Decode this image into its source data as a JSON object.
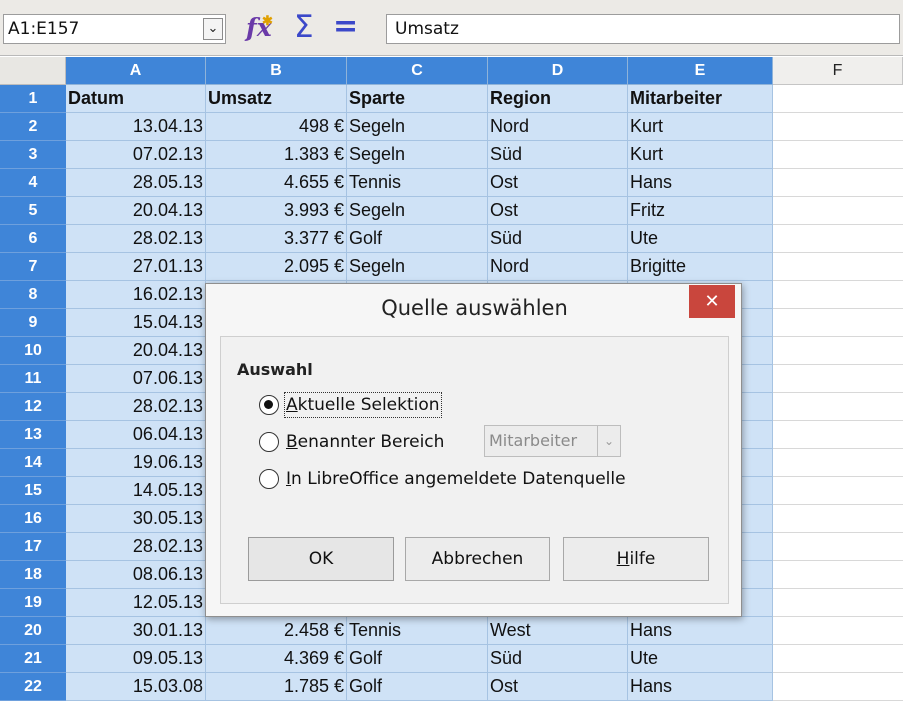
{
  "formula_bar": {
    "name_box": "A1:E157",
    "dropdown_glyph": "⌄",
    "function_wizard_icon": "function-wizard-icon",
    "fx_label": "fx",
    "sum_icon": "sum-icon",
    "sum_glyph": "Σ",
    "equals_icon": "equals-icon",
    "equals_glyph": "=",
    "content": "Umsatz"
  },
  "sheet": {
    "columns": [
      "A",
      "B",
      "C",
      "D",
      "E",
      "F"
    ],
    "rows": [
      {
        "num": "1",
        "cells": [
          "Datum",
          "Umsatz",
          "Sparte",
          "Region",
          "Mitarbeiter"
        ]
      },
      {
        "num": "2",
        "cells": [
          "13.04.13",
          "498 €",
          "Segeln",
          "Nord",
          "Kurt"
        ]
      },
      {
        "num": "3",
        "cells": [
          "07.02.13",
          "1.383 €",
          "Segeln",
          "Süd",
          "Kurt"
        ]
      },
      {
        "num": "4",
        "cells": [
          "28.05.13",
          "4.655 €",
          "Tennis",
          "Ost",
          "Hans"
        ]
      },
      {
        "num": "5",
        "cells": [
          "20.04.13",
          "3.993 €",
          "Segeln",
          "Ost",
          "Fritz"
        ]
      },
      {
        "num": "6",
        "cells": [
          "28.02.13",
          "3.377 €",
          "Golf",
          "Süd",
          "Ute"
        ]
      },
      {
        "num": "7",
        "cells": [
          "27.01.13",
          "2.095 €",
          "Segeln",
          "Nord",
          "Brigitte"
        ]
      },
      {
        "num": "8",
        "cells": [
          "16.02.13",
          "",
          "",
          "",
          ""
        ]
      },
      {
        "num": "9",
        "cells": [
          "15.04.13",
          "",
          "",
          "",
          ""
        ]
      },
      {
        "num": "10",
        "cells": [
          "20.04.13",
          "",
          "",
          "",
          ""
        ]
      },
      {
        "num": "11",
        "cells": [
          "07.06.13",
          "",
          "",
          "",
          ""
        ]
      },
      {
        "num": "12",
        "cells": [
          "28.02.13",
          "",
          "",
          "",
          ""
        ]
      },
      {
        "num": "13",
        "cells": [
          "06.04.13",
          "",
          "",
          "",
          ""
        ]
      },
      {
        "num": "14",
        "cells": [
          "19.06.13",
          "",
          "",
          "",
          ""
        ]
      },
      {
        "num": "15",
        "cells": [
          "14.05.13",
          "",
          "",
          "",
          ""
        ]
      },
      {
        "num": "16",
        "cells": [
          "30.05.13",
          "",
          "",
          "",
          ""
        ]
      },
      {
        "num": "17",
        "cells": [
          "28.02.13",
          "",
          "",
          "",
          ""
        ]
      },
      {
        "num": "18",
        "cells": [
          "08.06.13",
          "",
          "",
          "",
          ""
        ]
      },
      {
        "num": "19",
        "cells": [
          "12.05.13",
          "",
          "",
          "",
          ""
        ]
      },
      {
        "num": "20",
        "cells": [
          "30.01.13",
          "2.458 €",
          "Tennis",
          "West",
          "Hans"
        ]
      },
      {
        "num": "21",
        "cells": [
          "09.05.13",
          "4.369 €",
          "Golf",
          "Süd",
          "Ute"
        ]
      },
      {
        "num": "22",
        "cells": [
          "15.03.08",
          "1.785 €",
          "Golf",
          "Ost",
          "Hans"
        ]
      }
    ]
  },
  "dialog": {
    "title": "Quelle auswählen",
    "close_glyph": "✕",
    "group_label": "Auswahl",
    "options": [
      {
        "label": "Aktuelle Selektion",
        "selected": true
      },
      {
        "label": "Benannter Bereich",
        "selected": false
      },
      {
        "label": "In LibreOffice angemeldete Datenquelle",
        "selected": false
      }
    ],
    "named_range_select": "Mitarbeiter",
    "select_arrow_glyph": "⌄",
    "buttons": {
      "ok": "OK",
      "cancel": "Abbrechen",
      "help": "Hilfe"
    }
  },
  "colors": {
    "selection_header": "#3f85d8",
    "selection_fill": "#cfe2f6",
    "close_button": "#c9463d"
  }
}
